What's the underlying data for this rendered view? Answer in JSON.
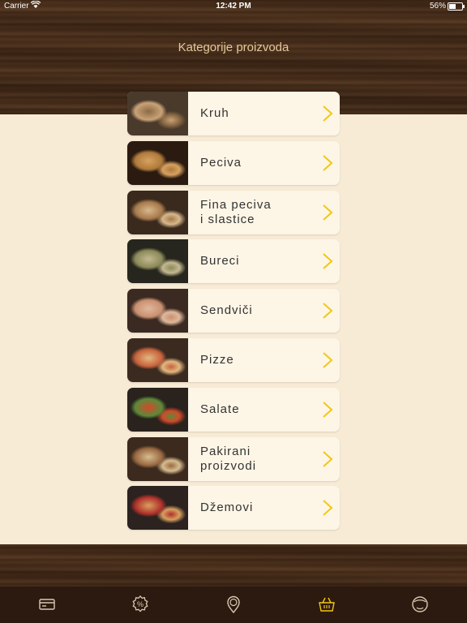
{
  "status_bar": {
    "carrier": "Carrier",
    "time": "12:42 PM",
    "battery": "56%"
  },
  "header": {
    "title": "Kategorije proizvoda"
  },
  "categories": [
    {
      "label": "Kruh",
      "thumb_colors": [
        "#4a3a2c",
        "#c9a277",
        "#8b6a45"
      ]
    },
    {
      "label": "Peciva",
      "thumb_colors": [
        "#2a1a10",
        "#b07a3c",
        "#d7a160"
      ]
    },
    {
      "label": "Fina peciva\ni slastice",
      "thumb_colors": [
        "#3a2a1e",
        "#a77a4c",
        "#d8b88c"
      ]
    },
    {
      "label": "Bureci",
      "thumb_colors": [
        "#26261e",
        "#8c8a5a",
        "#c4b890"
      ]
    },
    {
      "label": "Sendviči",
      "thumb_colors": [
        "#3a2a22",
        "#c99070",
        "#e0b89c"
      ]
    },
    {
      "label": "Pizze",
      "thumb_colors": [
        "#3a2a20",
        "#c8623c",
        "#e2b880"
      ]
    },
    {
      "label": "Salate",
      "thumb_colors": [
        "#2a221c",
        "#5c8a3a",
        "#d24a2a"
      ]
    },
    {
      "label": "Pakirani\nproizvodi",
      "thumb_colors": [
        "#3c2a1e",
        "#9a6a42",
        "#d8bc90"
      ]
    },
    {
      "label": "Džemovi",
      "thumb_colors": [
        "#2c2220",
        "#b0302a",
        "#d8a060"
      ]
    }
  ],
  "tab_bar": {
    "tabs": [
      {
        "icon": "card-icon"
      },
      {
        "icon": "discount-icon"
      },
      {
        "icon": "location-icon"
      },
      {
        "icon": "basket-icon",
        "active": true
      },
      {
        "icon": "profile-icon"
      }
    ]
  },
  "colors": {
    "accent": "#f0c814",
    "cream": "#f8ebd6",
    "row_bg": "#fdf5e6"
  }
}
